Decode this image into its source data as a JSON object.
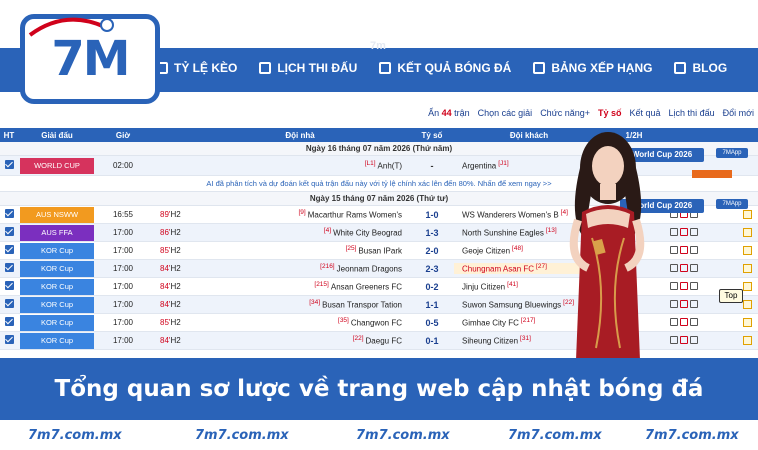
{
  "logo": {
    "text": "7M"
  },
  "nav": {
    "items": [
      {
        "label": "TỶ LỆ KÈO",
        "icon": "odds-icon"
      },
      {
        "label": "LỊCH THI ĐẤU",
        "icon": "calendar-icon"
      },
      {
        "label": "KẾT QUẢ BÓNG ĐÁ",
        "icon": "results-icon"
      },
      {
        "label": "BẢNG XẾP HẠNG",
        "icon": "ranking-icon"
      },
      {
        "label": "BLOG",
        "icon": "blog-icon"
      }
    ]
  },
  "filter": {
    "hidden_prefix": "Ẩn",
    "hidden_count": "44",
    "hidden_suffix": "trận",
    "select_all": "Chọn các giải",
    "more": "Chức năng+",
    "score_label": "Tỷ số",
    "results": "Kết quả",
    "schedule": "Lịch thi đấu",
    "more2": "Đổi mới"
  },
  "table": {
    "headers": {
      "ht": "HT",
      "league": "Giải đấu",
      "time": "Giờ",
      "home": "Đội nhà",
      "score": "Tỷ số",
      "away": "Đội khách",
      "half": "1/2H"
    },
    "day1": "Ngày 16 tháng 07 năm 2026 (Thứ năm)",
    "row_wc": {
      "league": "WORLD CUP",
      "time": "02:00",
      "home_rank": "[L1]",
      "home": "Anh(T)",
      "score": "-",
      "away": "Argentina",
      "away_rank": "[J1]"
    },
    "promo": "AI đã phân tích và dự đoán kết quả trận đấu này với tỷ lệ chính xác lên đến 80%. Nhấn để xem ngay >>",
    "day2": "Ngày 15 tháng 07 năm 2026 (Thứ tư)",
    "rows": [
      {
        "league": "AUS NSWW",
        "lg": "nsw",
        "time": "16:55",
        "minute": "89'",
        "half": "H2",
        "home_rank": "[9]",
        "home": "Macarthur Rams Women's",
        "score": "1-0",
        "away": "WS Wanderers Women's B",
        "away_rank": "[4]",
        "hl": false
      },
      {
        "league": "AUS FFA",
        "lg": "ffa",
        "time": "17:00",
        "minute": "86'",
        "half": "H2",
        "home_rank": "[4]",
        "home": "White City Beograd",
        "score": "1-3",
        "away": "North Sunshine Eagles",
        "away_rank": "[13]",
        "hl": false
      },
      {
        "league": "KOR Cup",
        "lg": "kor",
        "time": "17:00",
        "minute": "85'",
        "half": "H2",
        "home_rank": "[25]",
        "home": "Busan IPark",
        "score": "2-0",
        "away": "Geoje Citizen",
        "away_rank": "[48]",
        "hl": false
      },
      {
        "league": "KOR Cup",
        "lg": "kor",
        "time": "17:00",
        "minute": "84'",
        "half": "H2",
        "home_rank": "[216]",
        "home": "Jeonnam Dragons",
        "score": "2-3",
        "away": "Chungnam Asan FC",
        "away_rank": "[27]",
        "hl": true
      },
      {
        "league": "KOR Cup",
        "lg": "kor",
        "time": "17:00",
        "minute": "84'",
        "half": "H2",
        "home_rank": "[215]",
        "home": "Ansan Greeners FC",
        "score": "0-2",
        "away": "Jinju Citizen",
        "away_rank": "[41]",
        "hl": false
      },
      {
        "league": "KOR Cup",
        "lg": "kor",
        "time": "17:00",
        "minute": "84'",
        "half": "H2",
        "home_rank": "[34]",
        "home": "Busan Transpor Tation",
        "score": "1-1",
        "away": "Suwon Samsung Bluewings",
        "away_rank": "[22]",
        "hl": false
      },
      {
        "league": "KOR Cup",
        "lg": "kor",
        "time": "17:00",
        "minute": "85'",
        "half": "H2",
        "home_rank": "[35]",
        "home": "Changwon FC",
        "score": "0-5",
        "away": "Gimhae City FC",
        "away_rank": "[217]",
        "hl": false
      },
      {
        "league": "KOR Cup",
        "lg": "kor",
        "time": "17:00",
        "minute": "84'",
        "half": "H2",
        "home_rank": "[22]",
        "home": "Daegu FC",
        "score": "0-1",
        "away": "Siheung Citizen",
        "away_rank": "[31]",
        "hl": false
      }
    ]
  },
  "world_cup_badge": "World Cup 2026",
  "wc_btn": "7MApp",
  "top_btn": "Top",
  "banner": "Tổng quan sơ lược về trang web cập nhật bóng đá",
  "footer_watermark": "7m7.com.mx",
  "nav_watermark": "7m",
  "colors": {
    "brand_blue": "#2a63b8",
    "red": "#d0021b",
    "banner_text": "#ffffff"
  }
}
